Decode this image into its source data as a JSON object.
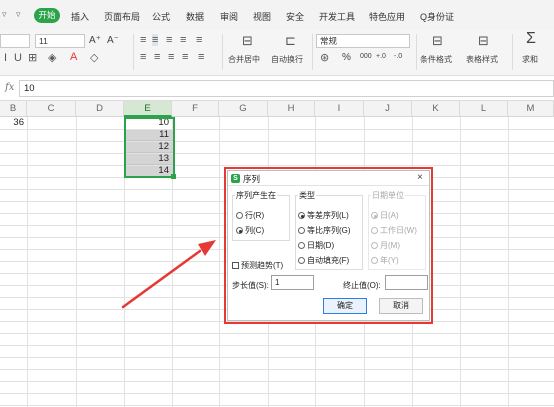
{
  "menu": {
    "quick_icons": [
      "▿",
      "▿"
    ],
    "start_tab": "开始",
    "tabs": [
      "插入",
      "页面布局",
      "公式",
      "数据",
      "审阅",
      "视图",
      "安全",
      "开发工具",
      "特色应用"
    ],
    "search_label": "Q身份证"
  },
  "toolbar": {
    "font_size": "11",
    "grow_font": "A⁺",
    "shrink_font": "A⁻",
    "merge_center": "合并居中",
    "wrap_text": "自动换行",
    "number_format": "常规",
    "percent": "%",
    "thousands": "000",
    "inc_decimal": "+.0",
    "dec_decimal": "-.0",
    "cond_format": "条件格式",
    "table_style": "表格样式",
    "sum": "求和",
    "sum_symbol": "Σ"
  },
  "formula_bar": {
    "fx_label": "fx",
    "value": "10"
  },
  "columns": [
    "B",
    "C",
    "D",
    "E",
    "F",
    "G",
    "H",
    "I",
    "J",
    "K",
    "L",
    "M"
  ],
  "selected_column": "E",
  "cells": {
    "b1": "36",
    "e_values": [
      "10",
      "11",
      "12",
      "13",
      "14"
    ]
  },
  "dialog": {
    "title": "序列",
    "close": "×",
    "series_in": {
      "label": "序列产生在",
      "row": "行(R)",
      "column": "列(C)",
      "selected": "column"
    },
    "type": {
      "label": "类型",
      "linear": "等差序列(L)",
      "growth": "等比序列(G)",
      "date": "日期(D)",
      "autofill": "自动填充(F)",
      "selected": "linear"
    },
    "date_unit": {
      "label": "日期单位",
      "day": "日(A)",
      "weekday": "工作日(W)",
      "month": "月(M)",
      "year": "年(Y)"
    },
    "trend": "预测趋势(T)",
    "step_label": "步长值(S):",
    "step_value": "1",
    "stop_label": "终止值(O):",
    "stop_value": "",
    "ok": "确定",
    "cancel": "取消"
  },
  "colors": {
    "accent": "#2ca24a",
    "highlight": "#e53935",
    "arrow": "#e53935"
  }
}
